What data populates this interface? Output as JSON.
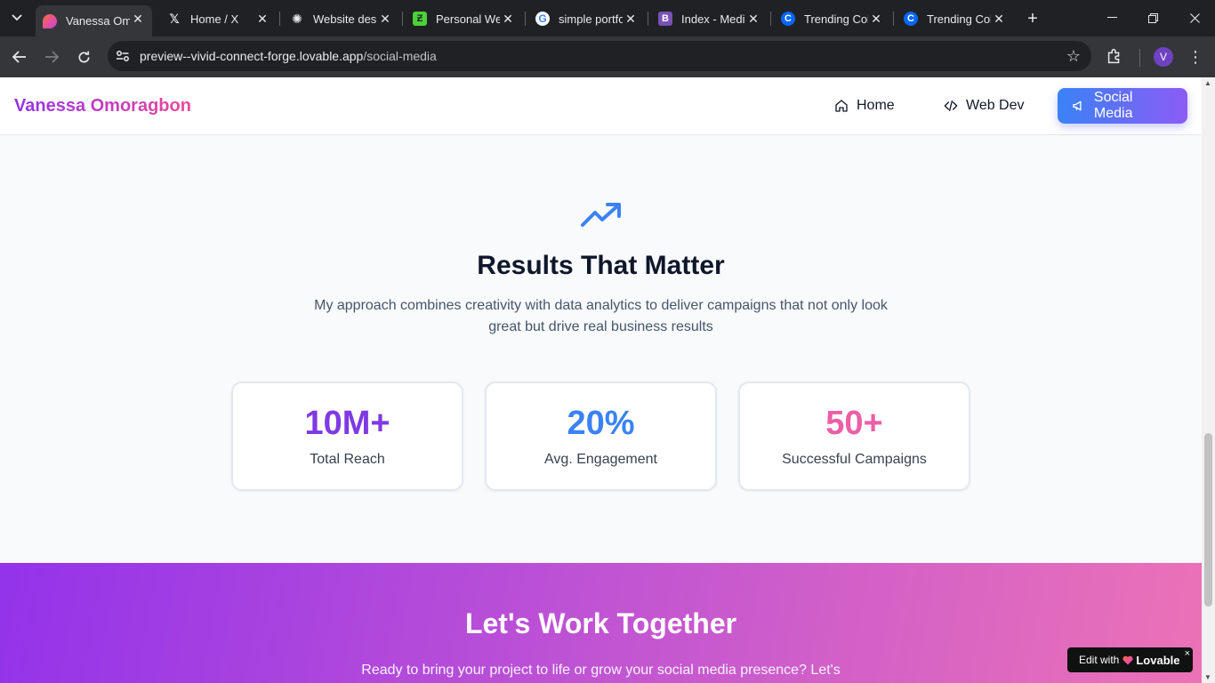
{
  "browser": {
    "tabs": [
      {
        "title": "Vanessa Omoragbon",
        "icon": "lovable-heart-icon",
        "active": true
      },
      {
        "title": "Home / X",
        "icon": "x-logo-icon",
        "active": false
      },
      {
        "title": "Website design",
        "icon": "openai-icon",
        "active": false
      },
      {
        "title": "Personal Website",
        "icon": "green-app-icon",
        "active": false
      },
      {
        "title": "simple portfolio",
        "icon": "google-icon",
        "active": false
      },
      {
        "title": "Index - Medium",
        "icon": "bootstrap-icon",
        "active": false
      },
      {
        "title": "Trending Colors",
        "icon": "coolors-icon",
        "active": false
      },
      {
        "title": "Trending Colors",
        "icon": "coolors-icon",
        "active": false
      }
    ],
    "url_host": "preview--vivid-connect-forge.lovable.app",
    "url_path": "/social-media",
    "profile_initial": "V"
  },
  "site": {
    "brand": "Vanessa Omoragbon",
    "nav": [
      {
        "label": "Home",
        "icon": "home-icon"
      },
      {
        "label": "Web Dev",
        "icon": "code-icon"
      },
      {
        "label": "Social Media",
        "icon": "megaphone-icon",
        "active": true
      }
    ]
  },
  "results": {
    "title": "Results That Matter",
    "description": "My approach combines creativity with data analytics to deliver campaigns that not only look great but drive real business results",
    "stats": [
      {
        "value": "10M+",
        "label": "Total Reach",
        "color": "#7e3ae3"
      },
      {
        "value": "20%",
        "label": "Avg. Engagement",
        "color": "#3b82f6"
      },
      {
        "value": "50+",
        "label": "Successful Campaigns",
        "color": "#ec5fa6"
      }
    ]
  },
  "cta": {
    "title": "Let's Work Together",
    "text": "Ready to bring your project to life or grow your social media presence? Let's"
  },
  "badge": {
    "prefix": "Edit with",
    "brand": "Lovable",
    "close": "×"
  }
}
